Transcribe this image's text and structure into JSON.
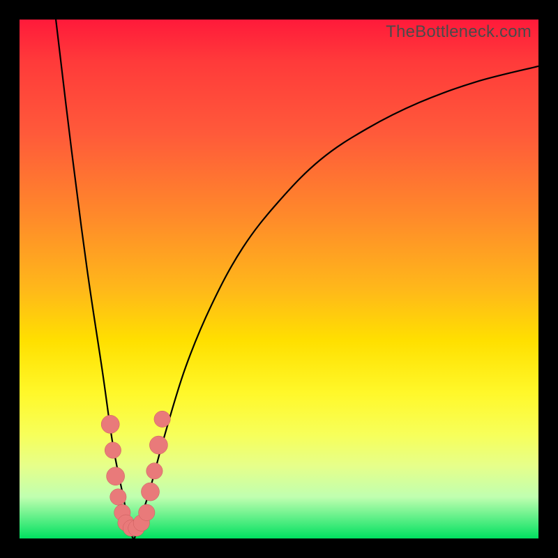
{
  "watermark": "TheBottleneck.com",
  "colors": {
    "frame": "#000000",
    "curve": "#000000",
    "dot_fill": "#e97a7a",
    "dot_stroke": "#c95a5a",
    "gradient_top": "#ff1a3a",
    "gradient_bottom": "#00e060"
  },
  "chart_data": {
    "type": "line",
    "title": "",
    "xlabel": "",
    "ylabel": "",
    "xlim": [
      0,
      100
    ],
    "ylim": [
      0,
      100
    ],
    "grid": false,
    "legend": null,
    "annotations": [
      "TheBottleneck.com"
    ],
    "background": "vertical gradient red→orange→yellow→green",
    "series": [
      {
        "name": "bottleneck-curve",
        "note": "V-shaped curve; minimum at x≈22, y≈0; values estimated from pixels on a 0–100 normalized axis",
        "x": [
          7,
          10,
          13,
          16,
          18,
          20,
          21,
          22,
          23,
          25,
          28,
          32,
          37,
          43,
          50,
          58,
          67,
          77,
          88,
          100
        ],
        "y": [
          100,
          75,
          52,
          32,
          18,
          8,
          3,
          0,
          3,
          9,
          20,
          33,
          45,
          56,
          65,
          73,
          79,
          84,
          88,
          91
        ]
      }
    ],
    "markers": [
      {
        "name": "highlight-dots",
        "note": "Soft red dots clustered near the curve minimum; (x,y) on same 0–100 scale, r≈dot radius in percent-units",
        "points": [
          {
            "x": 17.5,
            "y": 22,
            "r": 1.2
          },
          {
            "x": 18.0,
            "y": 17,
            "r": 1.0
          },
          {
            "x": 18.5,
            "y": 12,
            "r": 1.2
          },
          {
            "x": 19.0,
            "y": 8,
            "r": 1.0
          },
          {
            "x": 19.8,
            "y": 5,
            "r": 1.0
          },
          {
            "x": 20.5,
            "y": 3,
            "r": 1.0
          },
          {
            "x": 21.5,
            "y": 2,
            "r": 1.0
          },
          {
            "x": 22.5,
            "y": 2,
            "r": 1.0
          },
          {
            "x": 23.5,
            "y": 3,
            "r": 1.0
          },
          {
            "x": 24.5,
            "y": 5,
            "r": 1.0
          },
          {
            "x": 25.2,
            "y": 9,
            "r": 1.2
          },
          {
            "x": 26.0,
            "y": 13,
            "r": 1.0
          },
          {
            "x": 26.8,
            "y": 18,
            "r": 1.2
          },
          {
            "x": 27.5,
            "y": 23,
            "r": 1.0
          }
        ]
      }
    ]
  }
}
